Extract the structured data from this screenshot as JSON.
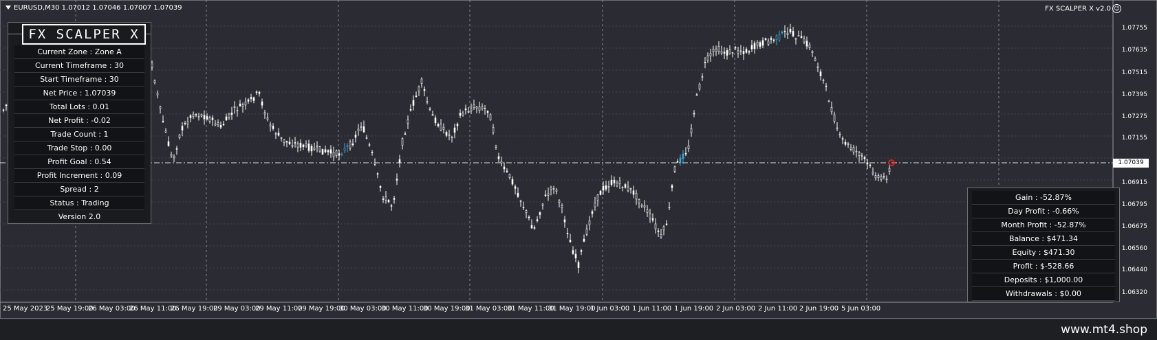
{
  "chart": {
    "symbol_line": "EURUSD,M30  1.07012 1.07046 1.07007 1.07039",
    "ea_name": "FX SCALPER X v2.0",
    "ea_icon": "smiley-icon",
    "current_price_label": "1.07039",
    "price_axis": [
      "1.07755",
      "1.07635",
      "1.07515",
      "1.07395",
      "1.07275",
      "1.07155",
      "1.06915",
      "1.06795",
      "1.06675",
      "1.06560",
      "1.06440",
      "1.06320"
    ],
    "time_axis": [
      "25 May 2023",
      "25 May 19:00",
      "26 May 03:00",
      "26 May 11:00",
      "26 May 19:00",
      "29 May 03:00",
      "29 May 11:00",
      "29 May 19:00",
      "30 May 03:00",
      "30 May 11:00",
      "30 May 19:00",
      "31 May 03:00",
      "31 May 11:00",
      "31 May 19:00",
      "1 Jun 03:00",
      "1 Jun 11:00",
      "1 Jun 19:00",
      "2 Jun 03:00",
      "2 Jun 11:00",
      "2 Jun 19:00",
      "5 Jun 03:00"
    ]
  },
  "left_panel": {
    "logo": "FX SCALPER X",
    "rows": [
      "Current Zone : Zone A",
      "Current Timeframe : 30",
      "Start Timeframe : 30",
      "Net Price : 1.07039",
      "Total Lots : 0.01",
      "Net Profit : -0.02",
      "Trade Count : 1",
      "Trade Stop : 0.00",
      "Profit Goal : 0.54",
      "Profit Increment : 0.09",
      "Spread : 2",
      "Status : Trading"
    ],
    "version": "Version 2.0"
  },
  "right_panel": {
    "rows": [
      "Gain : -52.87%",
      "Day Profit : -0.66%",
      "Month Profit : -52.87%",
      "Balance : $471.34",
      "Equity : $471.30",
      "Profit : $-528.66",
      "Deposits : $1,000.00",
      "Withdrawals : $0.00"
    ]
  },
  "footer": {
    "watermark": "www.mt4.shop"
  },
  "colors": {
    "background": "#2b2c33",
    "candle": "#ffffff",
    "grid": "#44454c",
    "price_line": "#e0e0e0",
    "order_marker": "#e02020",
    "accent_bars": "#3fa7d6"
  }
}
